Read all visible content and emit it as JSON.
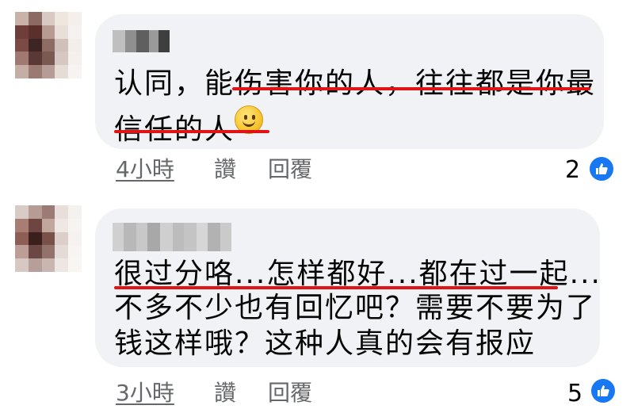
{
  "comments": [
    {
      "lines": [
        "认同，能伤害你的人，往往都是你最",
        "信任的人"
      ],
      "time": "4小時",
      "like_label": "讚",
      "reply_label": "回覆",
      "reaction_count": "2",
      "reaction_icon": "like-icon",
      "emoji_icon": "slightly-smiling-face-icon"
    },
    {
      "lines": [
        "很过分咯...怎样都好...都在过一起...",
        "不多不少也有回忆吧？需要不要为了",
        "钱这样哦？这种人真的会有报应"
      ],
      "time": "3小時",
      "like_label": "讚",
      "reply_label": "回覆",
      "reaction_count": "5",
      "reaction_icon": "like-icon"
    }
  ],
  "colors": {
    "bubble": "#f0f2f5",
    "underline": "#e01414",
    "meta_text": "#65676b",
    "like_blue": "#1877f2"
  }
}
